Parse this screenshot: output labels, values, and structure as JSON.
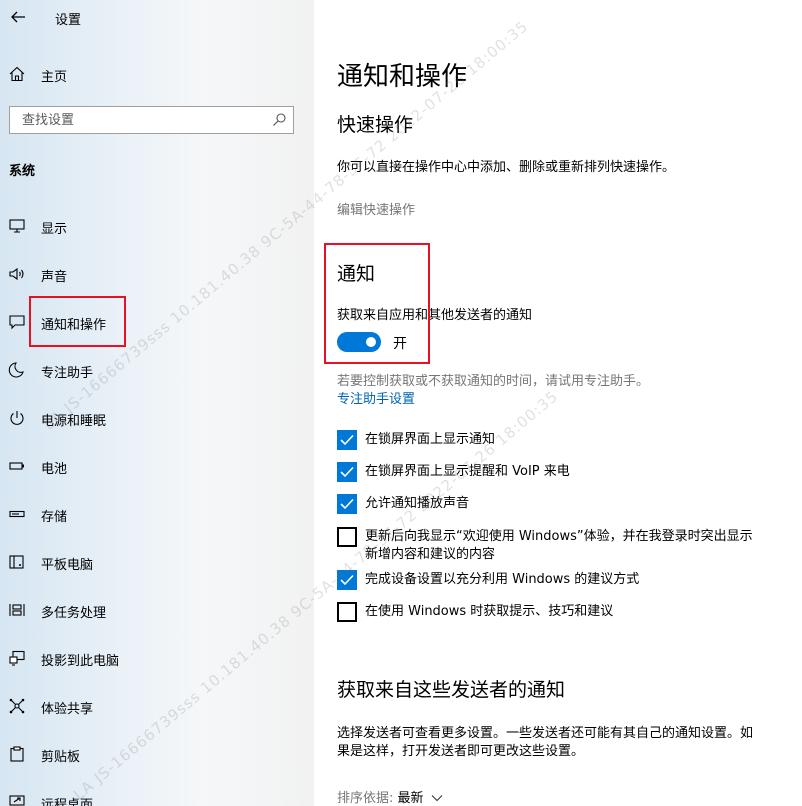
{
  "window": {
    "title": "设置"
  },
  "sidebar": {
    "home_label": "主页",
    "search_placeholder": "查找设置",
    "section_label": "系统",
    "items": [
      {
        "label": "显示",
        "icon": "monitor-icon"
      },
      {
        "label": "声音",
        "icon": "speaker-icon"
      },
      {
        "label": "通知和操作",
        "icon": "notification-icon",
        "selected": true
      },
      {
        "label": "专注助手",
        "icon": "moon-icon"
      },
      {
        "label": "电源和睡眠",
        "icon": "power-icon"
      },
      {
        "label": "电池",
        "icon": "battery-icon"
      },
      {
        "label": "存储",
        "icon": "storage-icon"
      },
      {
        "label": "平板电脑",
        "icon": "tablet-icon"
      },
      {
        "label": "多任务处理",
        "icon": "multitask-icon"
      },
      {
        "label": "投影到此电脑",
        "icon": "project-icon"
      },
      {
        "label": "体验共享",
        "icon": "share-icon"
      },
      {
        "label": "剪贴板",
        "icon": "clipboard-icon"
      },
      {
        "label": "远程桌面",
        "icon": "remote-desktop-icon"
      }
    ]
  },
  "main": {
    "title": "通知和操作",
    "quick_actions": {
      "heading": "快速操作",
      "description": "你可以直接在操作中心中添加、删除或重新排列快速操作。",
      "edit_link": "编辑快速操作"
    },
    "notifications": {
      "heading": "通知",
      "toggle_caption": "获取来自应用和其他发送者的通知",
      "toggle_state": "开",
      "toggle_on": true,
      "focus_hint": "若要控制获取或不获取通知的时间，请试用专注助手。",
      "focus_link": "专注助手设置",
      "checkboxes": [
        {
          "label": "在锁屏界面上显示通知",
          "checked": true
        },
        {
          "label": "在锁屏界面上显示提醒和 VoIP 来电",
          "checked": true
        },
        {
          "label": "允许通知播放声音",
          "checked": true
        },
        {
          "label": "更新后向我显示“欢迎使用 Windows”体验，并在我登录时突出显示",
          "label2": "新增内容和建议的内容",
          "checked": false
        },
        {
          "label": "完成设备设置以充分利用 Windows 的建议方式",
          "checked": true
        },
        {
          "label": "在使用 Windows 时获取提示、技巧和建议",
          "checked": false
        }
      ]
    },
    "senders": {
      "heading": "获取来自这些发送者的通知",
      "description_line1": "选择发送者可查看更多设置。一些发送者还可能有其自己的通知设置。如",
      "description_line2": "果是这样，打开发送者即可更改这些设置。",
      "sort_label": "排序依据:",
      "sort_value": "最新"
    }
  },
  "watermark": {
    "text": "LA JS-16666739sss 10.181.40.38 9C-5A-44-78-3F-72 2022-07-26 18:00:35"
  },
  "colors": {
    "accent": "#0078d7",
    "link": "#0063b1",
    "highlight": "#e81123"
  }
}
